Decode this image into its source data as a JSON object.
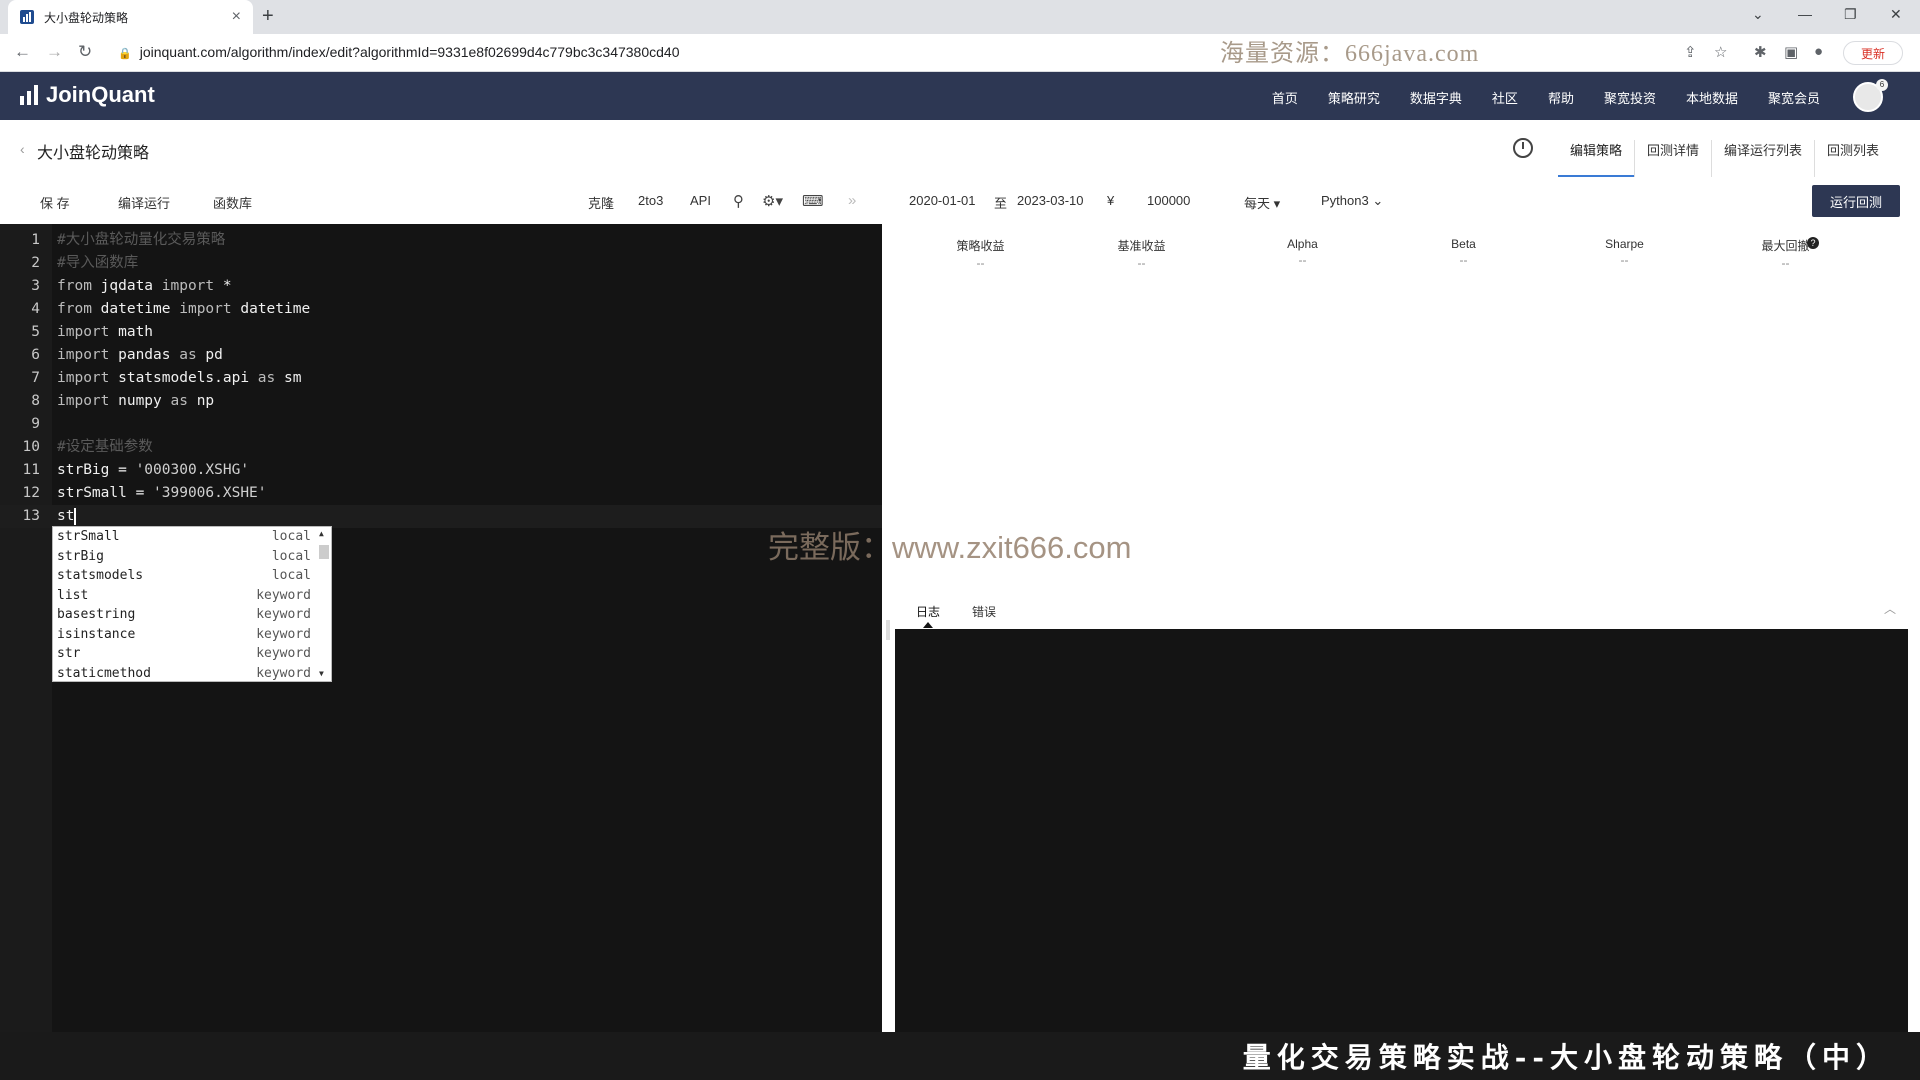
{
  "browser": {
    "tab_title": "大小盘轮动策略",
    "url": "joinquant.com/algorithm/index/edit?algorithmId=9331e8f02699d4c779bc3c347380cd40",
    "update_label": "更新",
    "watermark": "海量资源：666java.com"
  },
  "header": {
    "logo": "JoinQuant",
    "nav": [
      "首页",
      "策略研究",
      "数据字典",
      "社区",
      "帮助",
      "聚宽投资",
      "本地数据",
      "聚宽会员"
    ],
    "avatar_badge": "6"
  },
  "page": {
    "strategy_title": "大小盘轮动策略",
    "right_tabs": [
      "编辑策略",
      "回测详情",
      "编译运行列表",
      "回测列表"
    ]
  },
  "toolbar": {
    "save": "保 存",
    "compile_run": "编译运行",
    "library": "函数库",
    "clone": "克隆",
    "to3": "2to3",
    "api": "API",
    "start_date": "2020-01-01",
    "to": "至",
    "end_date": "2023-03-10",
    "currency": "¥",
    "capital": "100000",
    "frequency": "每天",
    "language": "Python3",
    "run_backtest": "运行回测"
  },
  "editor": {
    "lines": [
      {
        "n": "1",
        "parts": [
          {
            "t": "#大小盘轮动量化交易策略",
            "c": "cm"
          }
        ]
      },
      {
        "n": "2",
        "parts": [
          {
            "t": "#导入函数库",
            "c": "cm"
          }
        ]
      },
      {
        "n": "3",
        "parts": [
          {
            "t": "from",
            "c": "kw"
          },
          {
            "t": " jqdata ",
            "c": ""
          },
          {
            "t": "import",
            "c": "kw"
          },
          {
            "t": " *",
            "c": ""
          }
        ]
      },
      {
        "n": "4",
        "parts": [
          {
            "t": "from",
            "c": "kw"
          },
          {
            "t": " datetime ",
            "c": ""
          },
          {
            "t": "import",
            "c": "kw"
          },
          {
            "t": " datetime",
            "c": ""
          }
        ]
      },
      {
        "n": "5",
        "parts": [
          {
            "t": "import",
            "c": "kw"
          },
          {
            "t": " math",
            "c": ""
          }
        ]
      },
      {
        "n": "6",
        "parts": [
          {
            "t": "import",
            "c": "kw"
          },
          {
            "t": " pandas ",
            "c": ""
          },
          {
            "t": "as",
            "c": "kw"
          },
          {
            "t": " pd",
            "c": ""
          }
        ]
      },
      {
        "n": "7",
        "parts": [
          {
            "t": "import",
            "c": "kw"
          },
          {
            "t": " statsmodels.api ",
            "c": ""
          },
          {
            "t": "as",
            "c": "kw"
          },
          {
            "t": " sm",
            "c": ""
          }
        ]
      },
      {
        "n": "8",
        "parts": [
          {
            "t": "import",
            "c": "kw"
          },
          {
            "t": " numpy ",
            "c": ""
          },
          {
            "t": "as",
            "c": "kw"
          },
          {
            "t": " np",
            "c": ""
          }
        ]
      },
      {
        "n": "9",
        "parts": []
      },
      {
        "n": "10",
        "parts": [
          {
            "t": "#设定基础参数",
            "c": "cm"
          }
        ]
      },
      {
        "n": "11",
        "parts": [
          {
            "t": "strBig = ",
            "c": ""
          },
          {
            "t": "'000300.XSHG'",
            "c": "str"
          }
        ]
      },
      {
        "n": "12",
        "parts": [
          {
            "t": "strSmall = ",
            "c": ""
          },
          {
            "t": "'399006.XSHE'",
            "c": "str"
          }
        ]
      },
      {
        "n": "13",
        "parts": [
          {
            "t": "st",
            "c": ""
          }
        ]
      }
    ],
    "autocomplete": [
      {
        "name": "strSmall",
        "type": "local"
      },
      {
        "name": "strBig",
        "type": "local"
      },
      {
        "name": "statsmodels",
        "type": "local"
      },
      {
        "name": "list",
        "type": "keyword"
      },
      {
        "name": "basestring",
        "type": "keyword"
      },
      {
        "name": "isinstance",
        "type": "keyword"
      },
      {
        "name": "str",
        "type": "keyword"
      },
      {
        "name": "staticmethod",
        "type": "keyword"
      }
    ]
  },
  "watermark_mid": {
    "label": "完整版：",
    "url": "www.zxit666.com"
  },
  "metrics": [
    {
      "label": "策略收益",
      "value": "--"
    },
    {
      "label": "基准收益",
      "value": "--"
    },
    {
      "label": "Alpha",
      "value": "--"
    },
    {
      "label": "Beta",
      "value": "--"
    },
    {
      "label": "Sharpe",
      "value": "--"
    },
    {
      "label": "最大回撤",
      "value": "--"
    }
  ],
  "log_tabs": [
    "日志",
    "错误"
  ],
  "subtitle": "量化交易策略实战--大小盘轮动策略（中）",
  "colors": {
    "header_bg": "#2d3753",
    "editor_bg": "#141414",
    "accent": "#3a7bd5"
  }
}
